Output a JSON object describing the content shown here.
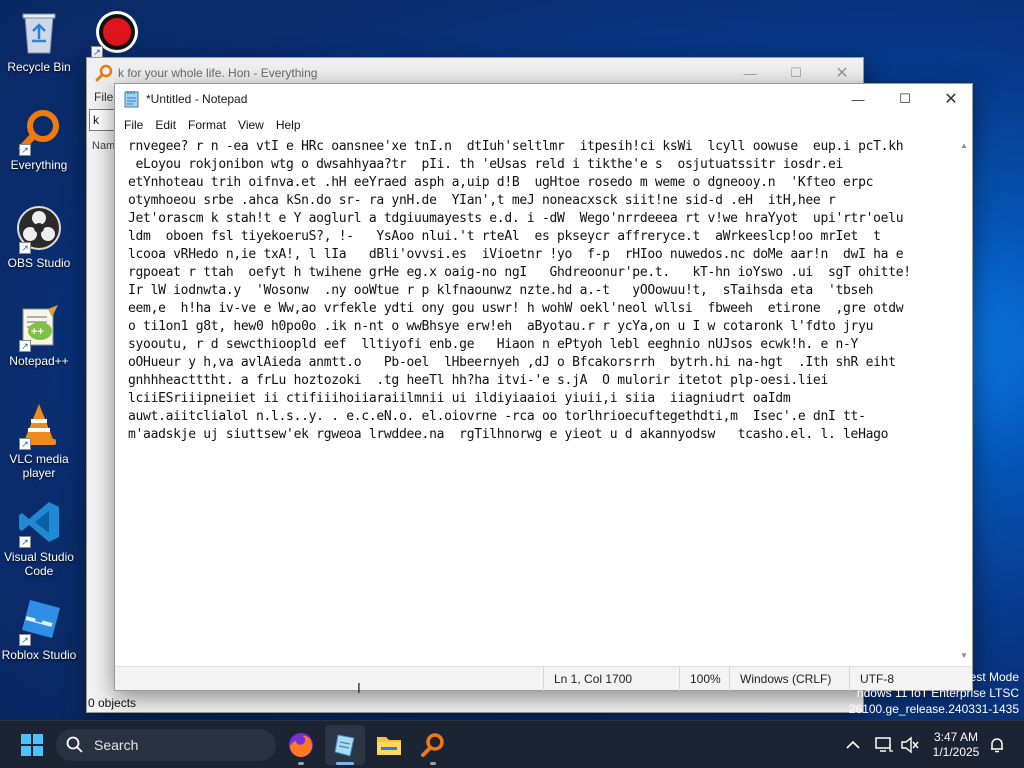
{
  "desktop": {
    "icons": [
      {
        "label": "Recycle Bin",
        "icon": "recycle-bin-icon"
      },
      {
        "label": "",
        "icon": "record-icon"
      },
      {
        "label": "Everything",
        "icon": "everything-icon"
      },
      {
        "label": "OBS Studio",
        "icon": "obs-icon"
      },
      {
        "label": "Notepad++",
        "icon": "notepadpp-icon"
      },
      {
        "label": "VLC media player",
        "icon": "vlc-icon"
      },
      {
        "label": "Visual Studio Code",
        "icon": "vscode-icon"
      },
      {
        "label": "Roblox Studio",
        "icon": "roblox-icon"
      }
    ],
    "watermark": {
      "line1": "est Mode",
      "line2": "ndows 11 IoT Enterprise LTSC",
      "line3": "26100.ge_release.240331-1435"
    }
  },
  "everything_window": {
    "title": "k for your whole life. Hon - Everything",
    "menu_file": "File",
    "search_value": "k for",
    "column_name": "Nam",
    "status": "0 objects"
  },
  "notepad": {
    "title": "*Untitled - Notepad",
    "menu": [
      "File",
      "Edit",
      "Format",
      "View",
      "Help"
    ],
    "content": "rnvegee? r n -ea vtI e HRc oansnee'xe tnI.n  dtIuh'seltlmr  itpesih!ci ksWi  lcyll oowuse  eup.i pcT.kh\n eLoyou rokjonibon wtg o dwsahhyaa?tr  pIi. th 'eUsas reld i tikthe'e s  osjutuatssitr iosdr.ei\netYnhoteau trih oifnva.et .hH eeYraed asph a,uip d!B  ugHtoe rosedo m weme o dgneooy.n  'Kfteo erpc\notymhoeou srbe .ahca kSn.do sr- ra ynH.de  YIan',t meJ noneacxsck siit!ne sid-d .eH  itH,hee r\nJet'orascm k stah!t e Y aoglurl a tdgiuumayests e.d. i -dW  Wego'nrrdeeea rt v!we hraYyot  upi'rtr'oelu\nldm  oboen fsl tiyekoeruS?, !-   YsAoo nlui.'t rteAl  es pkseycr affreryce.t  aWrkeeslcp!oo mrIet  t\nlcooa vRHedo n,ie txA!, l lIa   dBli'ovvsi.es  iVioetnr !yo  f-p  rHIoo nuwedos.nc doMe aar!n  dwI ha e\nrgpoeat r ttah  oefyt h twihene grHe eg.x oaig-no ngI   Ghdreoonur'pe.t.   kT-hn ioYswo .ui  sgT ohitte!\nIr lW iodnwta.y  'Wosonw  .ny ooWtue r p klfnaounwz nzte.hd a.-t   yOOowuu!t,  sTaihsda eta  'tbseh\neem,e  h!ha iv-ve e Ww,ao vrfekle ydti ony gou uswr! h wohW oekl'neol wllsi  fbweeh  etirone  ,gre otdw\no ti1on1 g8t, hew0 h0po0o .ik n-nt o wwBhsye erw!eh  aByotau.r r ycYa,on u I w cotaronk l'fdto jryu\nsyooutu, r d sewcthioopld eef  lltiyofi enb.ge   Hiaon n ePtyoh lebl eeghnio nUJsos ecwk!h. e n-Y\noOHueur y h,va avlAieda anmtt.o   Pb-oel  lHbeernyeh ,dJ o Bfcakorsrrh  bytrh.hi na-hgt  .Ith shR eiht\ngnhhheactttht. a frLu hoztozoki  .tg heeTl hh?ha itvi-'e s.jA  O mulorir itetot plp-oesi.liei\nlciiESriiipneiiet ii ctifiiihoiiaraiilmnii ui ildiyiaaioi yiuii,i siia  iiagniudrt oaIdm\nauwt.aiitclialol n.l.s..y. . e.c.eN.o. el.oiovrne -rca oo torlhrioecuftegethdti,m  Isec'.e dnI tt-\nm'aadskje uj siuttsew'ek rgweoa lrwddee.na  rgTilhnorwg e yieot u d akannyodsw   tcasho.el. l. leHago",
    "status": {
      "position": "Ln 1, Col 1700",
      "zoom": "100%",
      "line_ending": "Windows (CRLF)",
      "encoding": "UTF-8"
    }
  },
  "taskbar": {
    "search_label": "Search",
    "apps": [
      "firefox-icon",
      "notepad-icon",
      "file-explorer-icon",
      "everything-icon"
    ],
    "time": "3:47 AM",
    "date": "1/1/2025"
  }
}
